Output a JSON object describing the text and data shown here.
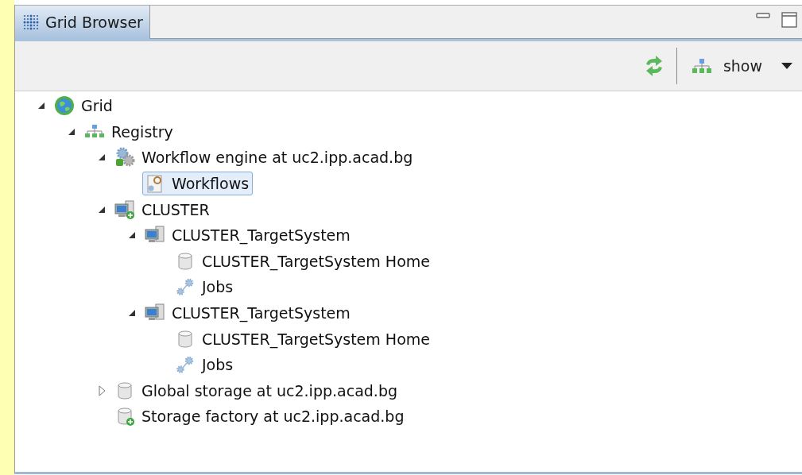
{
  "view_tab": {
    "title": "Grid Browser",
    "selected": true
  },
  "toolbar": {
    "show_label": "show"
  },
  "tree": [
    {
      "label": "Grid",
      "kind": "grid",
      "expanded": true,
      "selected": false,
      "children": [
        {
          "label": "Registry",
          "kind": "registry",
          "expanded": true,
          "selected": false,
          "children": [
            {
              "label": "Workflow engine at uc2.ipp.acad.bg",
              "kind": "workflow_engine",
              "expanded": true,
              "selected": false,
              "children": [
                {
                  "label": "Workflows",
                  "kind": "workflows",
                  "selected": true
                }
              ]
            },
            {
              "label": "CLUSTER",
              "kind": "site",
              "expanded": true,
              "selected": false,
              "children": [
                {
                  "label": "CLUSTER_TargetSystem",
                  "kind": "target_system",
                  "expanded": true,
                  "selected": false,
                  "children": [
                    {
                      "label": "CLUSTER_TargetSystem Home",
                      "kind": "storage",
                      "selected": false
                    },
                    {
                      "label": "Jobs",
                      "kind": "jobs",
                      "selected": false
                    }
                  ]
                },
                {
                  "label": "CLUSTER_TargetSystem",
                  "kind": "target_system",
                  "expanded": true,
                  "selected": false,
                  "children": [
                    {
                      "label": "CLUSTER_TargetSystem Home",
                      "kind": "storage",
                      "selected": false
                    },
                    {
                      "label": "Jobs",
                      "kind": "jobs",
                      "selected": false
                    }
                  ]
                }
              ]
            },
            {
              "label": "Global storage at uc2.ipp.acad.bg",
              "kind": "storage",
              "expanded": false,
              "selected": false
            },
            {
              "label": "Storage factory at uc2.ipp.acad.bg",
              "kind": "storage_factory",
              "selected": false
            }
          ]
        }
      ]
    }
  ]
}
